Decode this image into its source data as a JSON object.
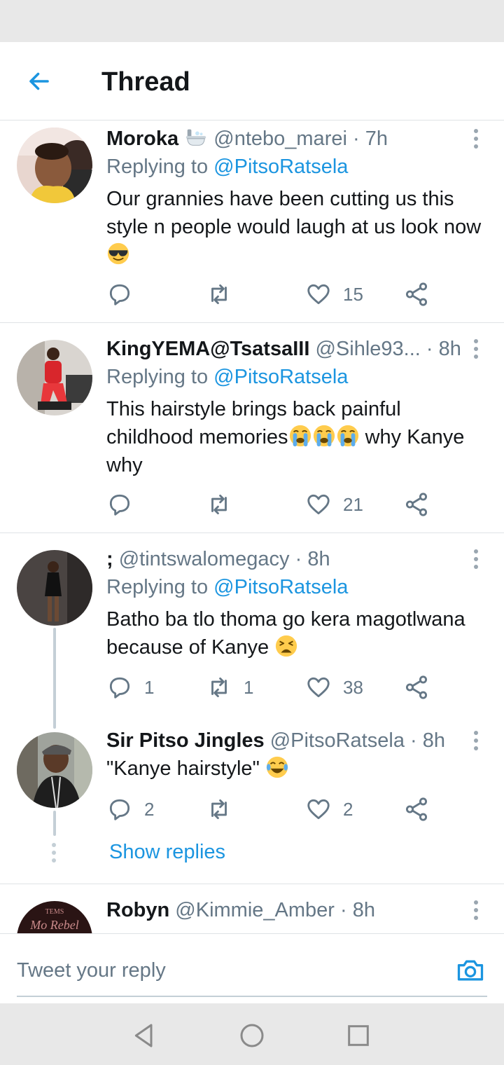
{
  "header": {
    "title": "Thread"
  },
  "tweets": [
    {
      "author": "Moroka",
      "author_emoji": "bathtub",
      "handle": "@ntebo_marei",
      "separator": "·",
      "time": "7h",
      "replying_prefix": "Replying to",
      "replying_to": "@PitsoRatsela",
      "text": "Our grannies have been cutting us this style n people would laugh at us look now",
      "text_emojis": [
        "smiling-face-with-sunglasses"
      ],
      "counts": {
        "reply": "",
        "retweet": "",
        "like": "15"
      }
    },
    {
      "author": "KingYEMA@TsatsaIII",
      "handle": "@Sihle93...",
      "separator": "·",
      "time": "8h",
      "replying_prefix": "Replying to",
      "replying_to": "@PitsoRatsela",
      "text_a": "This hairstyle brings back painful childhood memories",
      "text_b": " why Kanye why",
      "text_emojis": [
        "loudly-crying-face",
        "loudly-crying-face",
        "loudly-crying-face"
      ],
      "counts": {
        "reply": "",
        "retweet": "",
        "like": "21"
      }
    },
    {
      "author": ";",
      "handle": "@tintswalomegacy",
      "separator": "·",
      "time": "8h",
      "replying_prefix": "Replying to",
      "replying_to": "@PitsoRatsela",
      "text": "Batho ba tlo thoma go kera magotlwana because of Kanye",
      "text_emojis": [
        "tired-face"
      ],
      "counts": {
        "reply": "1",
        "retweet": "1",
        "like": "38"
      }
    },
    {
      "author": "Sir Pitso Jingles",
      "handle": "@PitsoRatsela",
      "separator": "·",
      "time": "8h",
      "text": "\"Kanye hairstyle\"",
      "text_emojis": [
        "face-with-tears-of-joy"
      ],
      "counts": {
        "reply": "2",
        "retweet": "",
        "like": "2"
      }
    },
    {
      "author": "Robyn",
      "handle": "@Kimmie_Amber",
      "separator": "·",
      "time": "8h",
      "avatar_text": [
        "TEMS",
        "Mo Rebel"
      ]
    }
  ],
  "show_replies": "Show replies",
  "compose": {
    "placeholder": "Tweet your reply"
  },
  "icons": {
    "back": "arrow-left-icon",
    "menu": "more-vertical-icon",
    "reply": "reply-bubble-icon",
    "retweet": "retweet-icon",
    "like": "heart-icon",
    "share": "share-icon",
    "camera": "camera-icon",
    "nav": [
      "nav-back-icon",
      "nav-home-icon",
      "nav-recents-icon"
    ]
  },
  "colors": {
    "accent": "#1b95e0",
    "muted": "#657786",
    "text": "#14171a",
    "divider": "#dfe3e6"
  }
}
